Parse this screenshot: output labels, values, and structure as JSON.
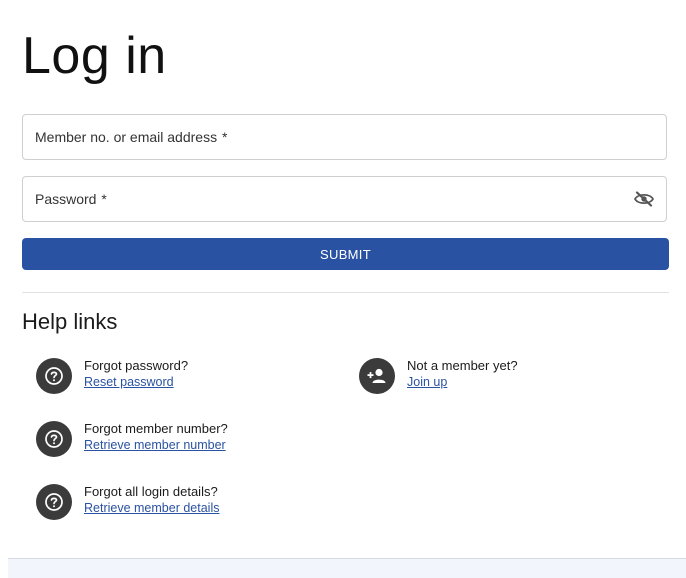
{
  "page": {
    "title": "Log in"
  },
  "form": {
    "member_label": "Member no. or email address",
    "password_label": "Password",
    "required_mark": "*",
    "submit_label": "SUBMIT"
  },
  "help": {
    "title": "Help links",
    "items": [
      {
        "question": "Forgot password?",
        "link": "Reset password",
        "icon": "question-circle-icon"
      },
      {
        "question": "Forgot member number?",
        "link": "Retrieve member number",
        "icon": "question-circle-icon"
      },
      {
        "question": "Forgot all login details?",
        "link": "Retrieve member details",
        "icon": "question-circle-icon"
      },
      {
        "question": "Not a member yet?",
        "link": "Join up",
        "icon": "add-person-icon"
      }
    ]
  },
  "colors": {
    "primary": "#2a52a2",
    "icon_bg": "#3b3b3b"
  }
}
